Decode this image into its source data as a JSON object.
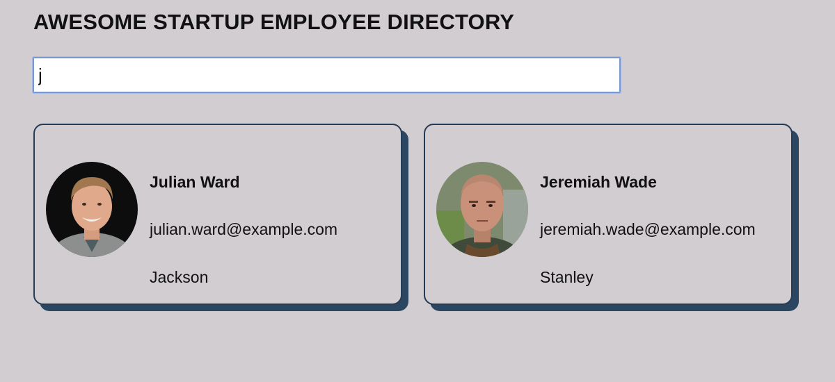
{
  "header": {
    "title": "AWESOME STARTUP EMPLOYEE DIRECTORY"
  },
  "search": {
    "value": "j",
    "placeholder": ""
  },
  "employees": [
    {
      "name": "Julian Ward",
      "email": "julian.ward@example.com",
      "city": "Jackson",
      "avatar_icon": "person-photo-avatar"
    },
    {
      "name": "Jeremiah Wade",
      "email": "jeremiah.wade@example.com",
      "city": "Stanley",
      "avatar_icon": "person-photo-avatar"
    }
  ],
  "colors": {
    "background": "#d2cdd1",
    "card_border": "#253b55",
    "card_shadow": "#2b4660",
    "search_focus": "#7a97cf"
  }
}
